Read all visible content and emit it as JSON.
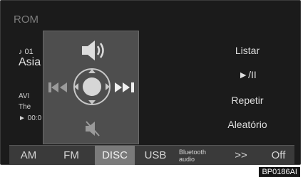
{
  "screen": {
    "title": "ROM",
    "track": "♪ 01",
    "album": "Asia",
    "artist": "AVI",
    "album_line": "The",
    "time": "► 00:0"
  },
  "right_buttons": {
    "list": "Listar",
    "play_pause": "►/II",
    "repeat": "Repetir",
    "random": "Aleatório"
  },
  "overlay": {
    "volume_icon": "speaker-icon",
    "prev_icon": "previous-track-icon",
    "next_icon": "next-track-icon",
    "mute_icon": "mute-icon"
  },
  "bottom_bar": {
    "am": "AM",
    "fm": "FM",
    "disc": "DISC",
    "usb": "USB",
    "bt_line1": "Bluetooth",
    "bt_line2": "audio",
    "more": ">>",
    "off": "Off"
  },
  "figure_code": "BP0186AI"
}
